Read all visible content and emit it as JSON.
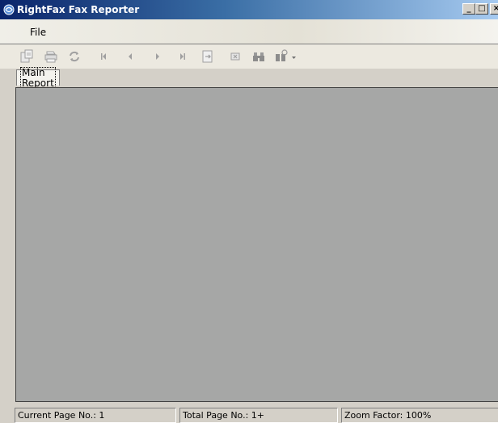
{
  "window": {
    "title": "RightFax Fax Reporter",
    "minimize_label": "_",
    "maximize_label": "□",
    "close_label": "×"
  },
  "menu": {
    "items": [
      {
        "label": "File"
      }
    ]
  },
  "toolbar": {
    "buttons": [
      {
        "icon": "export-icon",
        "enabled": false
      },
      {
        "icon": "print-icon",
        "enabled": false
      },
      {
        "icon": "refresh-icon",
        "enabled": false
      },
      {
        "icon": "first-page-icon",
        "enabled": false
      },
      {
        "icon": "previous-page-icon",
        "enabled": false
      },
      {
        "icon": "next-page-icon",
        "enabled": false
      },
      {
        "icon": "last-page-icon",
        "enabled": false
      },
      {
        "icon": "go-to-page-icon",
        "enabled": false
      },
      {
        "icon": "stop-icon",
        "enabled": false
      },
      {
        "icon": "search-binoculars-icon",
        "enabled": false
      },
      {
        "icon": "zoom-icon",
        "enabled": false
      }
    ]
  },
  "tabs": [
    {
      "label": "Main Report",
      "active": true
    }
  ],
  "report": {
    "background": "#a6a7a6"
  },
  "status": {
    "current_page": "Current Page No.: 1",
    "total_page": "Total Page No.: 1+",
    "zoom": "Zoom Factor: 100%"
  },
  "colors": {
    "titlebar_start": "#0a246a",
    "titlebar_end": "#a6caf0",
    "icon_disabled": "#a0a0a0"
  }
}
